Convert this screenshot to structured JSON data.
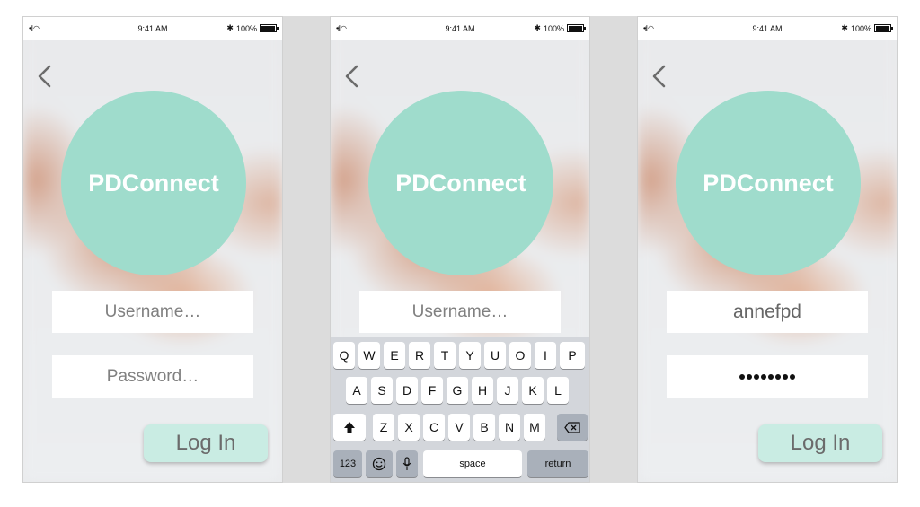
{
  "status_bar": {
    "signal": "•ıl",
    "wifi": "◠",
    "time": "9:41 AM",
    "bluetooth": "✱",
    "battery": "100%"
  },
  "brand": {
    "app_name": "PDConnect",
    "circle_color": "#9fdccc"
  },
  "screens": [
    {
      "username": "Username…",
      "password": "Password…",
      "login_label": "Log In"
    },
    {
      "username": "Username…"
    },
    {
      "username": "annefpd",
      "password_dots": 8,
      "login_label": "Log In"
    }
  ],
  "keyboard": {
    "row1": [
      "Q",
      "W",
      "E",
      "R",
      "T",
      "Y",
      "U",
      "O",
      "I",
      "P"
    ],
    "row2": [
      "A",
      "S",
      "D",
      "F",
      "G",
      "H",
      "J",
      "K",
      "L"
    ],
    "row3": [
      "Z",
      "X",
      "C",
      "V",
      "B",
      "N",
      "M"
    ],
    "shift_icon": "shift-arrow",
    "delete_icon": "backspace",
    "key_123": "123",
    "emoji_icon": "smiley",
    "mic_icon": "microphone",
    "space": "space",
    "return": "return"
  }
}
